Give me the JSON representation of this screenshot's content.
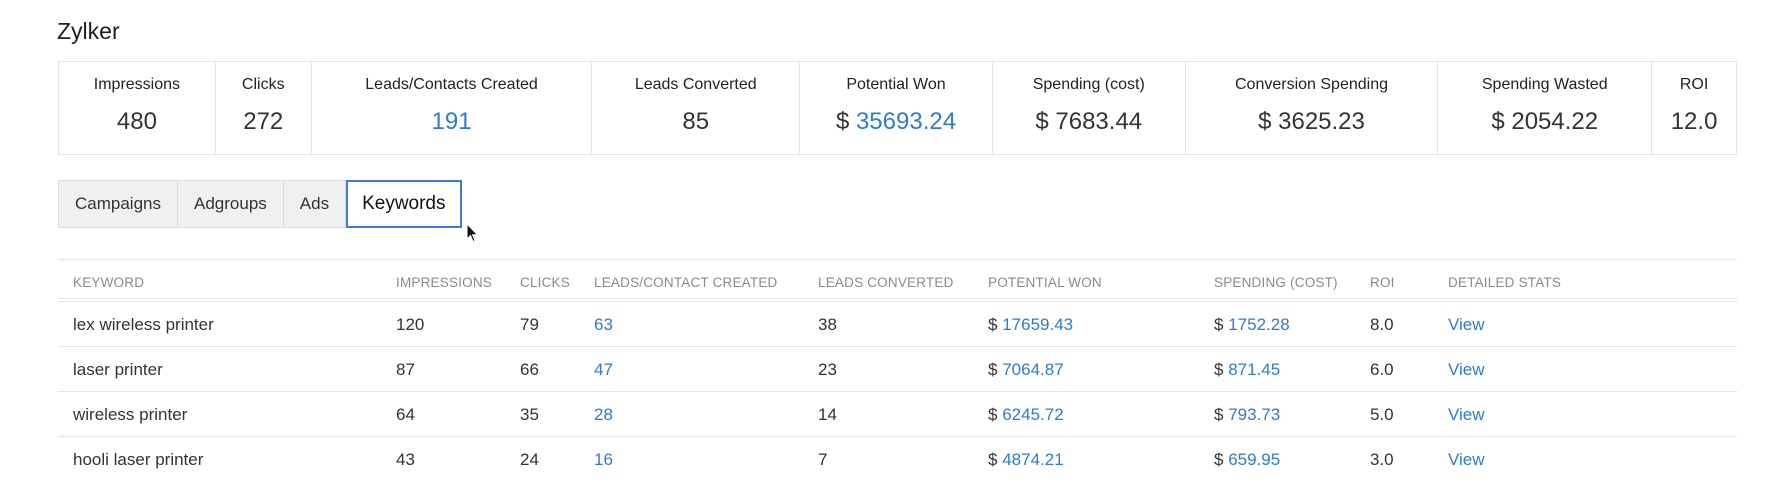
{
  "page": {
    "title": "Zylker"
  },
  "summary": [
    {
      "label": "Impressions",
      "prefix": "",
      "value": "480",
      "is_link": false
    },
    {
      "label": "Clicks",
      "prefix": "",
      "value": "272",
      "is_link": false
    },
    {
      "label": "Leads/Contacts Created",
      "prefix": "",
      "value": "191",
      "is_link": true
    },
    {
      "label": "Leads Converted",
      "prefix": "",
      "value": "85",
      "is_link": false
    },
    {
      "label": "Potential Won",
      "prefix": "$ ",
      "value": "35693.24",
      "is_link": true
    },
    {
      "label": "Spending (cost)",
      "prefix": "$ ",
      "value": "7683.44",
      "is_link": false
    },
    {
      "label": "Conversion Spending",
      "prefix": "$ ",
      "value": "3625.23",
      "is_link": false
    },
    {
      "label": "Spending Wasted",
      "prefix": "$ ",
      "value": "2054.22",
      "is_link": false
    },
    {
      "label": "ROI",
      "prefix": "",
      "value": "12.0",
      "is_link": false
    }
  ],
  "tabs": [
    {
      "label": "Campaigns",
      "active": false
    },
    {
      "label": "Adgroups",
      "active": false
    },
    {
      "label": "Ads",
      "active": false
    },
    {
      "label": "Keywords",
      "active": true
    }
  ],
  "table": {
    "headers": [
      "KEYWORD",
      "IMPRESSIONS",
      "CLICKS",
      "LEADS/CONTACT CREATED",
      "LEADS CONVERTED",
      "POTENTIAL WON",
      "SPENDING (COST)",
      "ROI",
      "DETAILED STATS"
    ],
    "currency_symbol": "$",
    "rows": [
      {
        "keyword": "lex wireless printer",
        "impressions": "120",
        "clicks": "79",
        "leads_created": "63",
        "leads_converted": "38",
        "potential_won": "17659.43",
        "spending": "1752.28",
        "roi": "8.0",
        "detail": "View"
      },
      {
        "keyword": "laser printer",
        "impressions": "87",
        "clicks": "66",
        "leads_created": "47",
        "leads_converted": "23",
        "potential_won": "7064.87",
        "spending": "871.45",
        "roi": "6.0",
        "detail": "View"
      },
      {
        "keyword": "wireless printer",
        "impressions": "64",
        "clicks": "35",
        "leads_created": "28",
        "leads_converted": "14",
        "potential_won": "6245.72",
        "spending": "793.73",
        "roi": "5.0",
        "detail": "View"
      },
      {
        "keyword": "hooli laser printer",
        "impressions": "43",
        "clicks": "24",
        "leads_created": "16",
        "leads_converted": "7",
        "potential_won": "4874.21",
        "spending": "659.95",
        "roi": "3.0",
        "detail": "View"
      }
    ]
  },
  "colors": {
    "link": "#2e7bd6",
    "active_tab_border": "#3b7ddd"
  }
}
